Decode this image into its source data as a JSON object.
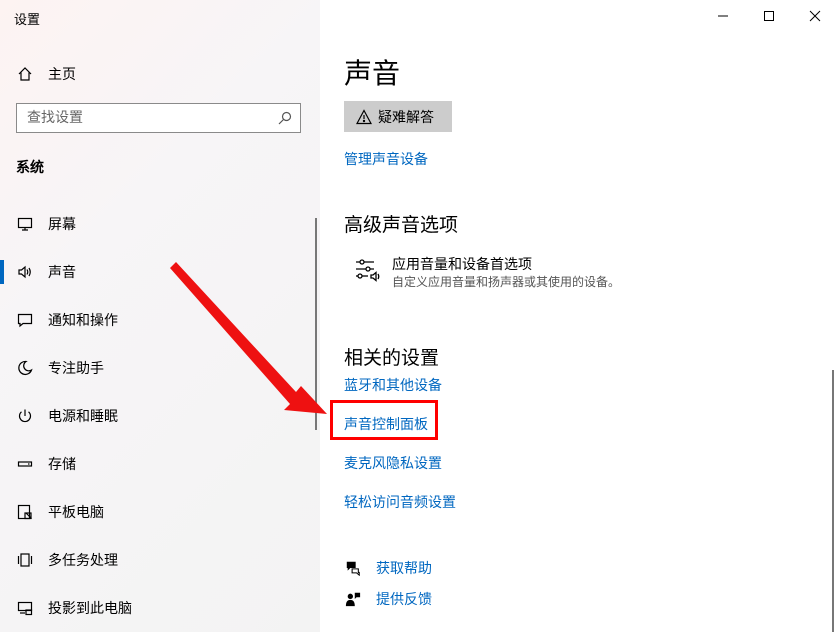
{
  "app": {
    "title": "设置"
  },
  "sidebar": {
    "home_label": "主页",
    "search_placeholder": "查找设置",
    "section_title": "系统",
    "items": [
      {
        "label": "屏幕",
        "icon": "monitor-icon"
      },
      {
        "label": "声音",
        "icon": "speaker-icon",
        "active": true
      },
      {
        "label": "通知和操作",
        "icon": "notification-icon"
      },
      {
        "label": "专注助手",
        "icon": "moon-icon"
      },
      {
        "label": "电源和睡眠",
        "icon": "power-icon"
      },
      {
        "label": "存储",
        "icon": "storage-icon"
      },
      {
        "label": "平板电脑",
        "icon": "tablet-icon"
      },
      {
        "label": "多任务处理",
        "icon": "multitask-icon"
      },
      {
        "label": "投影到此电脑",
        "icon": "project-icon"
      }
    ]
  },
  "main": {
    "title": "声音",
    "troubleshoot_label": "疑难解答",
    "manage_devices_link": "管理声音设备",
    "advanced": {
      "heading": "高级声音选项",
      "item_title": "应用音量和设备首选项",
      "item_desc": "自定义应用音量和扬声器或其使用的设备。"
    },
    "related": {
      "heading": "相关的设置",
      "links": [
        "蓝牙和其他设备",
        "声音控制面板",
        "麦克风隐私设置",
        "轻松访问音频设置"
      ]
    },
    "help": {
      "get_help": "获取帮助",
      "feedback": "提供反馈"
    }
  },
  "colors": {
    "accent": "#0067c0",
    "highlight": "#ff0000"
  }
}
